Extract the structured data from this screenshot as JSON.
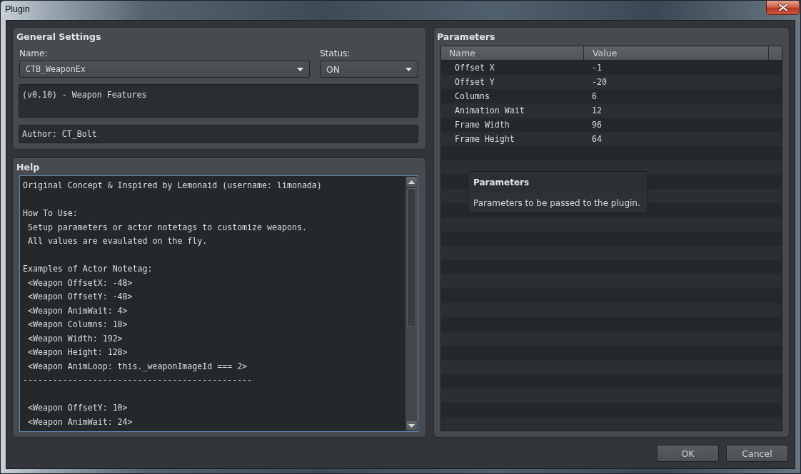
{
  "window": {
    "title": "Plugin"
  },
  "general_settings": {
    "title": "General Settings",
    "name": {
      "label": "Name:",
      "value": "CTB_WeaponEx"
    },
    "status": {
      "label": "Status:",
      "value": "ON"
    },
    "description": "(v0.10) - Weapon Features",
    "author": "Author: CT_Bolt"
  },
  "help": {
    "title": "Help",
    "focused": true,
    "paragraphs": [
      [
        "Original Concept & Inspired by Lemonaid (username: limonada)"
      ],
      [
        "How To Use:",
        " Setup parameters or actor notetags to customize weapons.",
        " All values are evaulated on the fly."
      ],
      [
        "Examples of Actor Notetag:",
        " <Weapon OffsetX: -48>",
        " <Weapon OffsetY: -48>",
        " <Weapon AnimWait: 4>",
        " <Weapon Columns: 18>",
        " <Weapon Width: 192>",
        " <Weapon Height: 128>",
        " <Weapon AnimLoop: this._weaponImageId === 2>",
        "----------------------------------------------"
      ],
      [
        " <Weapon OffsetY: 10>",
        " <Weapon AnimWait: 24>"
      ]
    ]
  },
  "parameters": {
    "title": "Parameters",
    "columns": [
      "Name",
      "Value"
    ],
    "rows": [
      {
        "name": "Offset X",
        "value": "-1"
      },
      {
        "name": "Offset Y",
        "value": "-20"
      },
      {
        "name": "Columns",
        "value": "6"
      },
      {
        "name": "Animation Wait",
        "value": "12"
      },
      {
        "name": "Frame Width",
        "value": "96"
      },
      {
        "name": "Frame Height",
        "value": "64"
      }
    ],
    "tooltip": {
      "title": "Parameters",
      "text": "Parameters to be passed to the plugin."
    }
  },
  "buttons": [
    {
      "label": "OK"
    },
    {
      "label": "Cancel"
    }
  ]
}
